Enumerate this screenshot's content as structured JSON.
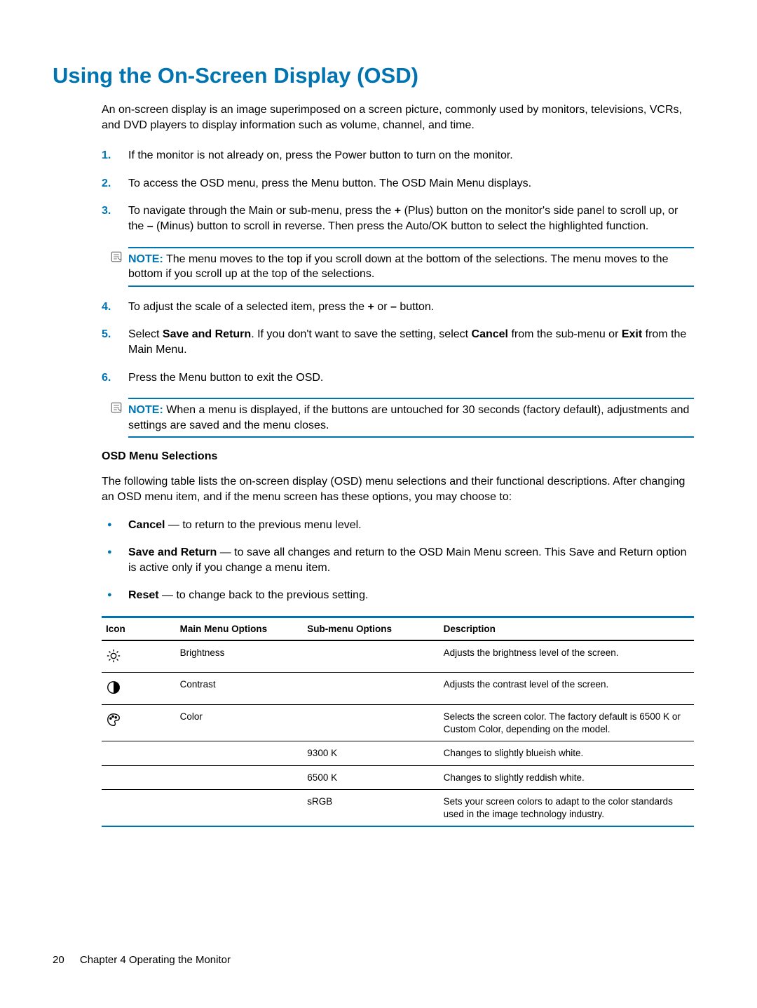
{
  "heading": "Using the On-Screen Display (OSD)",
  "intro": "An on-screen display is an image superimposed on a screen picture, commonly used by monitors, televisions, VCRs, and DVD players to display information such as volume, channel, and time.",
  "steps": [
    "If the monitor is not already on, press the Power button to turn on the monitor.",
    "To access the OSD menu, press the Menu button. The OSD Main Menu displays.",
    "To navigate through the Main or sub-menu, press the <b>+</b> (Plus) button on the monitor's side panel to scroll up, or the <b>–</b> (Minus) button to scroll in reverse. Then press the Auto/OK button to select the highlighted function.",
    "To adjust the scale of a selected item, press the <b>+</b> or <b>–</b> button.",
    "Select <b>Save and Return</b>. If you don't want to save the setting, select <b>Cancel</b> from the sub-menu or <b>Exit</b> from the Main Menu.",
    "Press the Menu button to exit the OSD."
  ],
  "note1_label": "NOTE:",
  "note1_text": "The menu moves to the top if you scroll down at the bottom of the selections. The menu moves to the bottom if you scroll up at the top of the selections.",
  "note2_label": "NOTE:",
  "note2_text": "When a menu is displayed, if the buttons are untouched for 30 seconds (factory default), adjustments and settings are saved and the menu closes.",
  "subheading": "OSD Menu Selections",
  "body_text": "The following table lists the on-screen display (OSD) menu selections and their functional descriptions. After changing an OSD menu item, and if the menu screen has these options, you may choose to:",
  "bullets": [
    {
      "term": "Cancel",
      "text": " — to return to the previous menu level."
    },
    {
      "term": "Save and Return",
      "text": " — to save all changes and return to the OSD Main Menu screen. This Save and Return option is active only if you change a menu item."
    },
    {
      "term": "Reset",
      "text": " — to change back to the previous setting."
    }
  ],
  "table": {
    "headers": [
      "Icon",
      "Main Menu Options",
      "Sub-menu Options",
      "Description"
    ],
    "rows": [
      {
        "icon": "brightness-icon",
        "main": "Brightness",
        "sub": "",
        "desc": "Adjusts the brightness level of the screen."
      },
      {
        "icon": "contrast-icon",
        "main": "Contrast",
        "sub": "",
        "desc": "Adjusts the contrast level of the screen."
      },
      {
        "icon": "color-icon",
        "main": "Color",
        "sub": "",
        "desc": "Selects the screen color. The factory default is 6500 K or Custom Color, depending on the model."
      },
      {
        "icon": "",
        "main": "",
        "sub": "9300 K",
        "desc": "Changes to slightly blueish white."
      },
      {
        "icon": "",
        "main": "",
        "sub": "6500 K",
        "desc": "Changes to slightly reddish white."
      },
      {
        "icon": "",
        "main": "",
        "sub": "sRGB",
        "desc": "Sets your screen colors to adapt to the color standards used in the image technology industry."
      }
    ]
  },
  "footer": {
    "page": "20",
    "chapter": "Chapter 4   Operating the Monitor"
  }
}
